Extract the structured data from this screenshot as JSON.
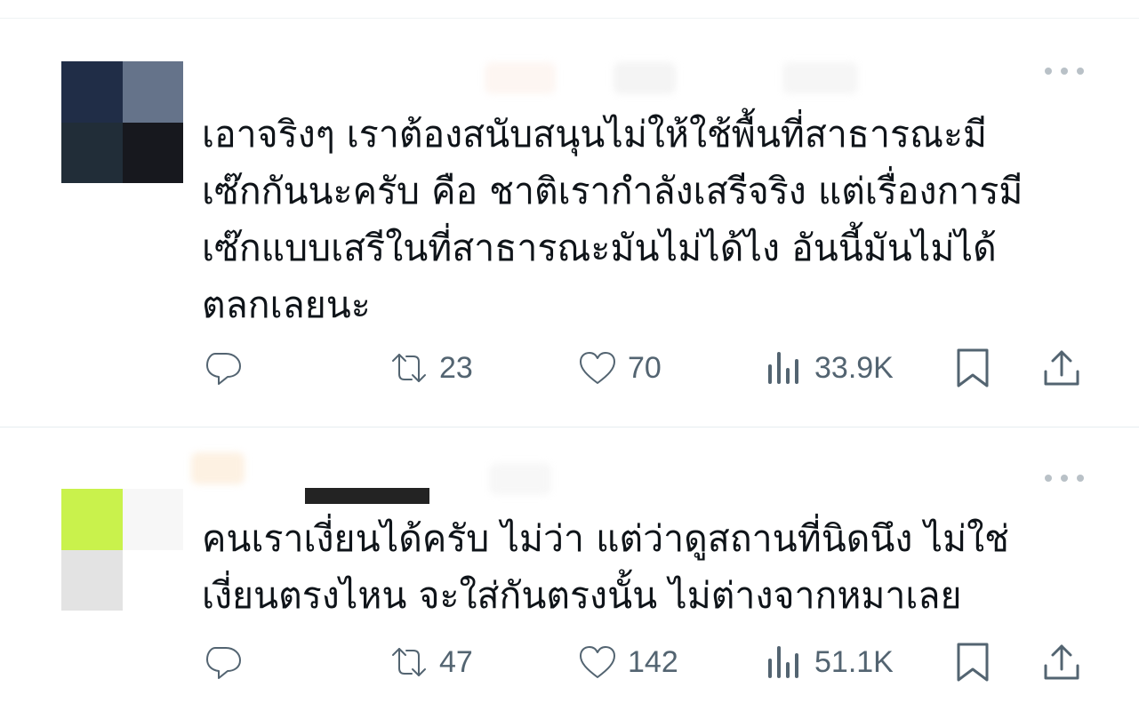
{
  "colors": {
    "text_primary": "#0f1419",
    "text_secondary": "#536471",
    "divider": "#e6ecf0",
    "background": "#ffffff"
  },
  "posts": [
    {
      "text": "เอาจริงๆ เราต้องสนับสนุนไม่ให้ใช้พื้นที่สาธารณะมี\nเซ๊กกันนะครับ คือ ชาติเรากำลังเสรีจริง แต่เรื่องการมี\nเซ๊กแบบเสรีในที่สาธารณะมันไม่ได้ไง อันนี้มันไม่ได้\nตลกเลยนะ",
      "avatar_colors": [
        "#202d47",
        "#65738a",
        "#212d38",
        "#17181e"
      ],
      "name_blur_colors": [
        "#fdf6f2",
        "#f4f4f4",
        "#f6f6f6"
      ],
      "retweets": "23",
      "likes": "70",
      "views": "33.9K",
      "icons": {
        "more": "more-icon",
        "reply": "reply-icon",
        "retweet": "retweet-icon",
        "like": "heart-icon",
        "views": "views-icon",
        "bookmark": "bookmark-icon",
        "share": "share-icon"
      }
    },
    {
      "text": "คนเราเงี่ยนได้ครับ ไม่ว่า แต่ว่าดูสถานที่นิดนึง ไม่ใช่\nเงี่ยนตรงไหน จะใส่กันตรงนั้น ไม่ต่างจากหมาเลย",
      "avatar_colors": [
        "#c9f24c",
        "#f7f7f7",
        "#e3e3e3",
        "#ffffff"
      ],
      "name_blur_colors": [
        "#fdf1e2",
        "#232323",
        "#f7f7f7"
      ],
      "retweets": "47",
      "likes": "142",
      "views": "51.1K",
      "icons": {
        "more": "more-icon",
        "reply": "reply-icon",
        "retweet": "retweet-icon",
        "like": "heart-icon",
        "views": "views-icon",
        "bookmark": "bookmark-icon",
        "share": "share-icon"
      }
    }
  ]
}
